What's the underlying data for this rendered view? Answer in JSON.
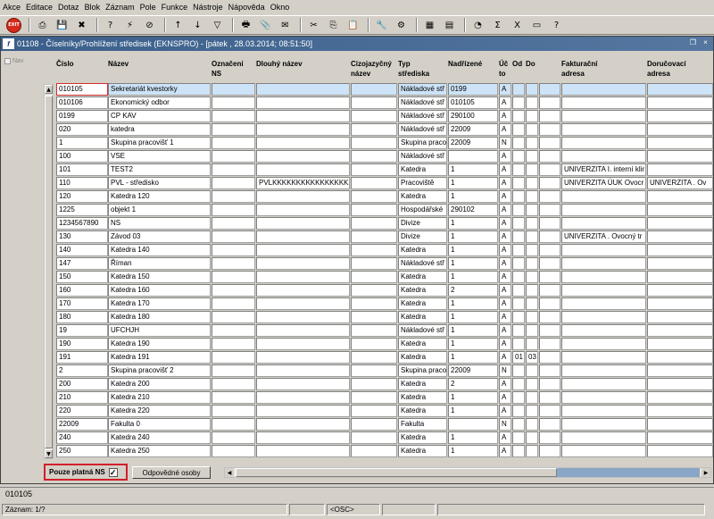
{
  "menu": [
    "Akce",
    "Editace",
    "Dotaz",
    "Blok",
    "Záznam",
    "Pole",
    "Funkce",
    "Nástroje",
    "Nápověda",
    "Okno"
  ],
  "toolbar": {
    "exit_label": "EXIT",
    "icons": [
      "print-icon",
      "save-icon",
      "delete-icon",
      "enter-query-icon",
      "execute-query-icon",
      "cancel-query-icon",
      "sort-asc-icon",
      "sort-desc-icon",
      "filter-icon",
      "printer-icon",
      "attach-icon",
      "mail-icon",
      "cut-icon",
      "copy-icon",
      "paste-icon",
      "tools-icon",
      "settings-icon",
      "calc-icon",
      "report-icon",
      "chart-icon",
      "sum-icon",
      "excel-icon",
      "window-icon",
      "help-icon"
    ]
  },
  "window": {
    "icon": "f",
    "title": "01108 - Číselníky/Prohlížení středisek (EKNSPRO) - [pátek , 28.03.2014; 08:51:50]",
    "restore_glyph": "❐",
    "close_glyph": "×"
  },
  "nav_label": "Nav",
  "columns": [
    {
      "l1": "Číslo",
      "l2": ""
    },
    {
      "l1": "Název",
      "l2": ""
    },
    {
      "l1": "Označení",
      "l2": "NS"
    },
    {
      "l1": "Dlouhý název",
      "l2": ""
    },
    {
      "l1": "Cizojazyčný",
      "l2": "název"
    },
    {
      "l1": "Typ",
      "l2": "střediska"
    },
    {
      "l1": "Nadřízené",
      "l2": ""
    },
    {
      "l1": "Úč",
      "l2": "to"
    },
    {
      "l1": "Od",
      "l2": ""
    },
    {
      "l1": "Do",
      "l2": ""
    },
    {
      "l1": "",
      "l2": ""
    },
    {
      "l1": "Fakturační",
      "l2": "adresa"
    },
    {
      "l1": "Doručovací",
      "l2": "adresa"
    }
  ],
  "rows": [
    [
      "010105",
      "Sekretariát kvestorky",
      "",
      "",
      "",
      "Nákladové stř",
      "0199",
      "A",
      "",
      "",
      "",
      "",
      ""
    ],
    [
      "010106",
      "Ekonomický odbor",
      "",
      "",
      "",
      "Nákladové stř",
      "010105",
      "A",
      "",
      "",
      "",
      "",
      ""
    ],
    [
      "0199",
      "CP KAV",
      "",
      "",
      "",
      "Nákladové stř",
      "290100",
      "A",
      "",
      "",
      "",
      "",
      ""
    ],
    [
      "020",
      "katedra",
      "",
      "",
      "",
      "Nákladové stř",
      "22009",
      "A",
      "",
      "",
      "",
      "",
      ""
    ],
    [
      "1",
      "Skupina pracovišť 1",
      "",
      "",
      "",
      "Skupina praco",
      "22009",
      "N",
      "",
      "",
      "",
      "",
      ""
    ],
    [
      "100",
      "VSE",
      "",
      "",
      "",
      "Nákladové stř",
      "",
      "A",
      "",
      "",
      "",
      "",
      ""
    ],
    [
      "101",
      "TEST2",
      "",
      "",
      "",
      "Katedra",
      "1",
      "A",
      "",
      "",
      "",
      "UNIVERZITA  I. interní klir",
      ""
    ],
    [
      "110",
      "PVL - středisko",
      "",
      "PVLKKKKKKKKKKKKKKKKK",
      "",
      "Pracoviště",
      "1",
      "A",
      "",
      "",
      "",
      "UNIVERZITA ÚUK Ovocr",
      "UNIVERZITA . Ov"
    ],
    [
      "120",
      "Katedra 120",
      "",
      "",
      "",
      "Katedra",
      "1",
      "A",
      "",
      "",
      "",
      "",
      ""
    ],
    [
      "1225",
      "objekt 1",
      "",
      "",
      "",
      "Hospodářské",
      "290102",
      "A",
      "",
      "",
      "",
      "",
      ""
    ],
    [
      "1234567890",
      "NS",
      "",
      "",
      "",
      "Divize",
      "1",
      "A",
      "",
      "",
      "",
      "",
      ""
    ],
    [
      "130",
      "Závod 03",
      "",
      "",
      "",
      "Divize",
      "1",
      "A",
      "",
      "",
      "",
      "UNIVERZITA . Ovocný tr",
      ""
    ],
    [
      "140",
      "Katedra 140",
      "",
      "",
      "",
      "Katedra",
      "1",
      "A",
      "",
      "",
      "",
      "",
      ""
    ],
    [
      "147",
      "Říman",
      "",
      "",
      "",
      "Nákladové stř",
      "1",
      "A",
      "",
      "",
      "",
      "",
      ""
    ],
    [
      "150",
      "Katedra 150",
      "",
      "",
      "",
      "Katedra",
      "1",
      "A",
      "",
      "",
      "",
      "",
      ""
    ],
    [
      "160",
      "Katedra 160",
      "",
      "",
      "",
      "Katedra",
      "2",
      "A",
      "",
      "",
      "",
      "",
      ""
    ],
    [
      "170",
      "Katedra 170",
      "",
      "",
      "",
      "Katedra",
      "1",
      "A",
      "",
      "",
      "",
      "",
      ""
    ],
    [
      "180",
      "Katedra 180",
      "",
      "",
      "",
      "Katedra",
      "1",
      "A",
      "",
      "",
      "",
      "",
      ""
    ],
    [
      "19",
      "UFCHJH",
      "",
      "",
      "",
      "Nákladové stř",
      "1",
      "A",
      "",
      "",
      "",
      "",
      ""
    ],
    [
      "190",
      "Katedra 190",
      "",
      "",
      "",
      "Katedra",
      "1",
      "A",
      "",
      "",
      "",
      "",
      ""
    ],
    [
      "191",
      "Katedra 191",
      "",
      "",
      "",
      "Katedra",
      "1",
      "A",
      "01",
      "03",
      "",
      "",
      ""
    ],
    [
      "2",
      "Skupina pracovišť 2",
      "",
      "",
      "",
      "Skupina praco",
      "22009",
      "N",
      "",
      "",
      "",
      "",
      ""
    ],
    [
      "200",
      "Katedra 200",
      "",
      "",
      "",
      "Katedra",
      "2",
      "A",
      "",
      "",
      "",
      "",
      ""
    ],
    [
      "210",
      "Katedra 210",
      "",
      "",
      "",
      "Katedra",
      "1",
      "A",
      "",
      "",
      "",
      "",
      ""
    ],
    [
      "220",
      "Katedra 220",
      "",
      "",
      "",
      "Katedra",
      "1",
      "A",
      "",
      "",
      "",
      "",
      ""
    ],
    [
      "22009",
      "Fakulta 0",
      "",
      "",
      "",
      "Fakulta",
      "",
      "N",
      "",
      "",
      "",
      "",
      ""
    ],
    [
      "240",
      "Katedra 240",
      "",
      "",
      "",
      "Katedra",
      "1",
      "A",
      "",
      "",
      "",
      "",
      ""
    ],
    [
      "250",
      "Katedra 250",
      "",
      "",
      "",
      "Katedra",
      "1",
      "A",
      "",
      "",
      "",
      "",
      ""
    ]
  ],
  "filter": {
    "label": "Pouze platná NS",
    "checked_glyph": "✓"
  },
  "responsible_button": "Odpovědné osoby",
  "status": {
    "current_value": "010105",
    "record": "Záznam: 1/?",
    "osc": "<OSC>"
  },
  "colors": {
    "selection": "#cde3f7",
    "highlight_border": "#d03030",
    "title_bar": "#3a5f8a"
  }
}
